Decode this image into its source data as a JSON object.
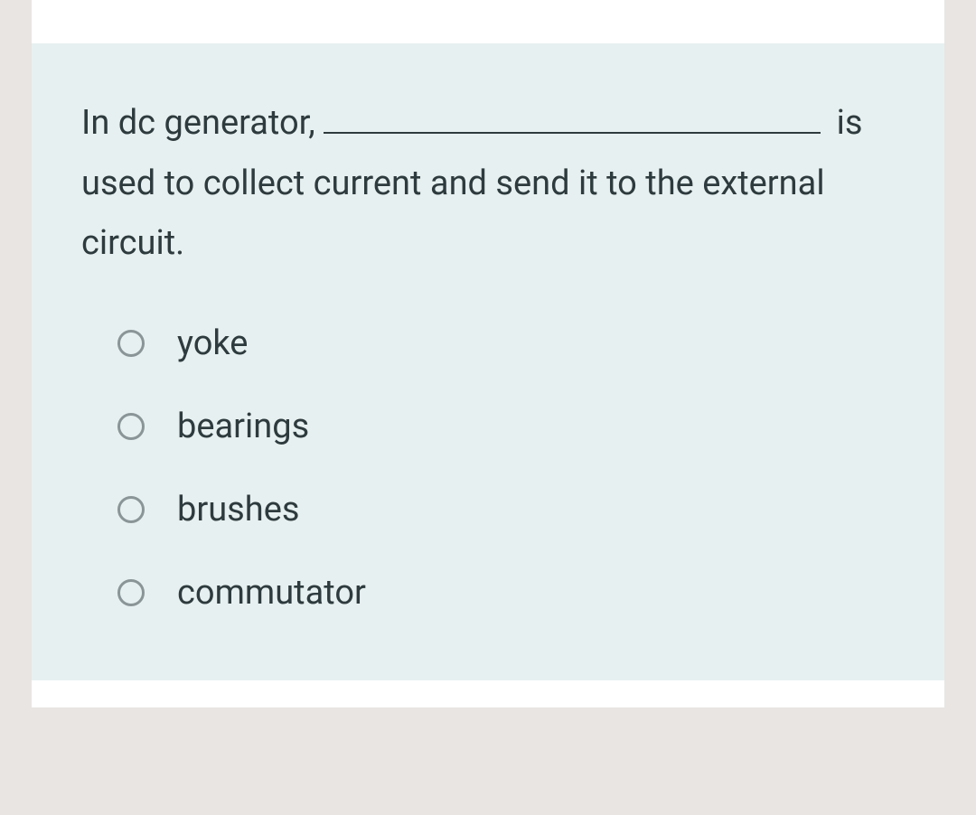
{
  "question": {
    "prefix": "In dc generator,",
    "suffix": "is used to collect current and send it to the external circuit."
  },
  "options": [
    {
      "label": "yoke"
    },
    {
      "label": "bearings"
    },
    {
      "label": "brushes"
    },
    {
      "label": "commutator"
    }
  ]
}
